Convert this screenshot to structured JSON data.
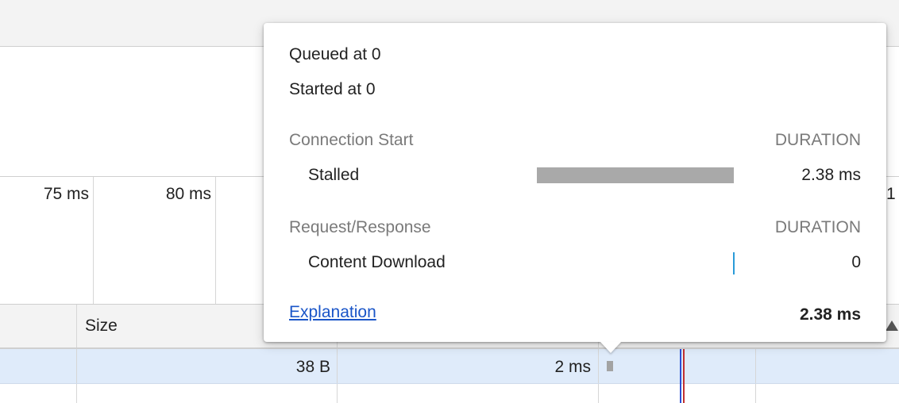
{
  "timeline": {
    "ticks": [
      "75 ms",
      "80 ms",
      "1"
    ]
  },
  "table": {
    "columns": {
      "size": "Size"
    },
    "row": {
      "size": "38 B",
      "time": "2 ms"
    }
  },
  "popover": {
    "queued": "Queued at 0",
    "started": "Started at 0",
    "connection": {
      "title": "Connection Start",
      "duration_label": "DURATION",
      "rows": [
        {
          "label": "Stalled",
          "value": "2.38 ms",
          "fraction": 1.0
        }
      ]
    },
    "request": {
      "title": "Request/Response",
      "duration_label": "DURATION",
      "rows": [
        {
          "label": "Content Download",
          "value": "0",
          "fraction": 0
        }
      ]
    },
    "explanation_link": "Explanation",
    "total": "2.38 ms"
  },
  "colors": {
    "stalled_bar": "#a9a9a9",
    "download_bar": "#2a9bd8",
    "link": "#1a55c8",
    "selected_row": "#dfebfa"
  }
}
